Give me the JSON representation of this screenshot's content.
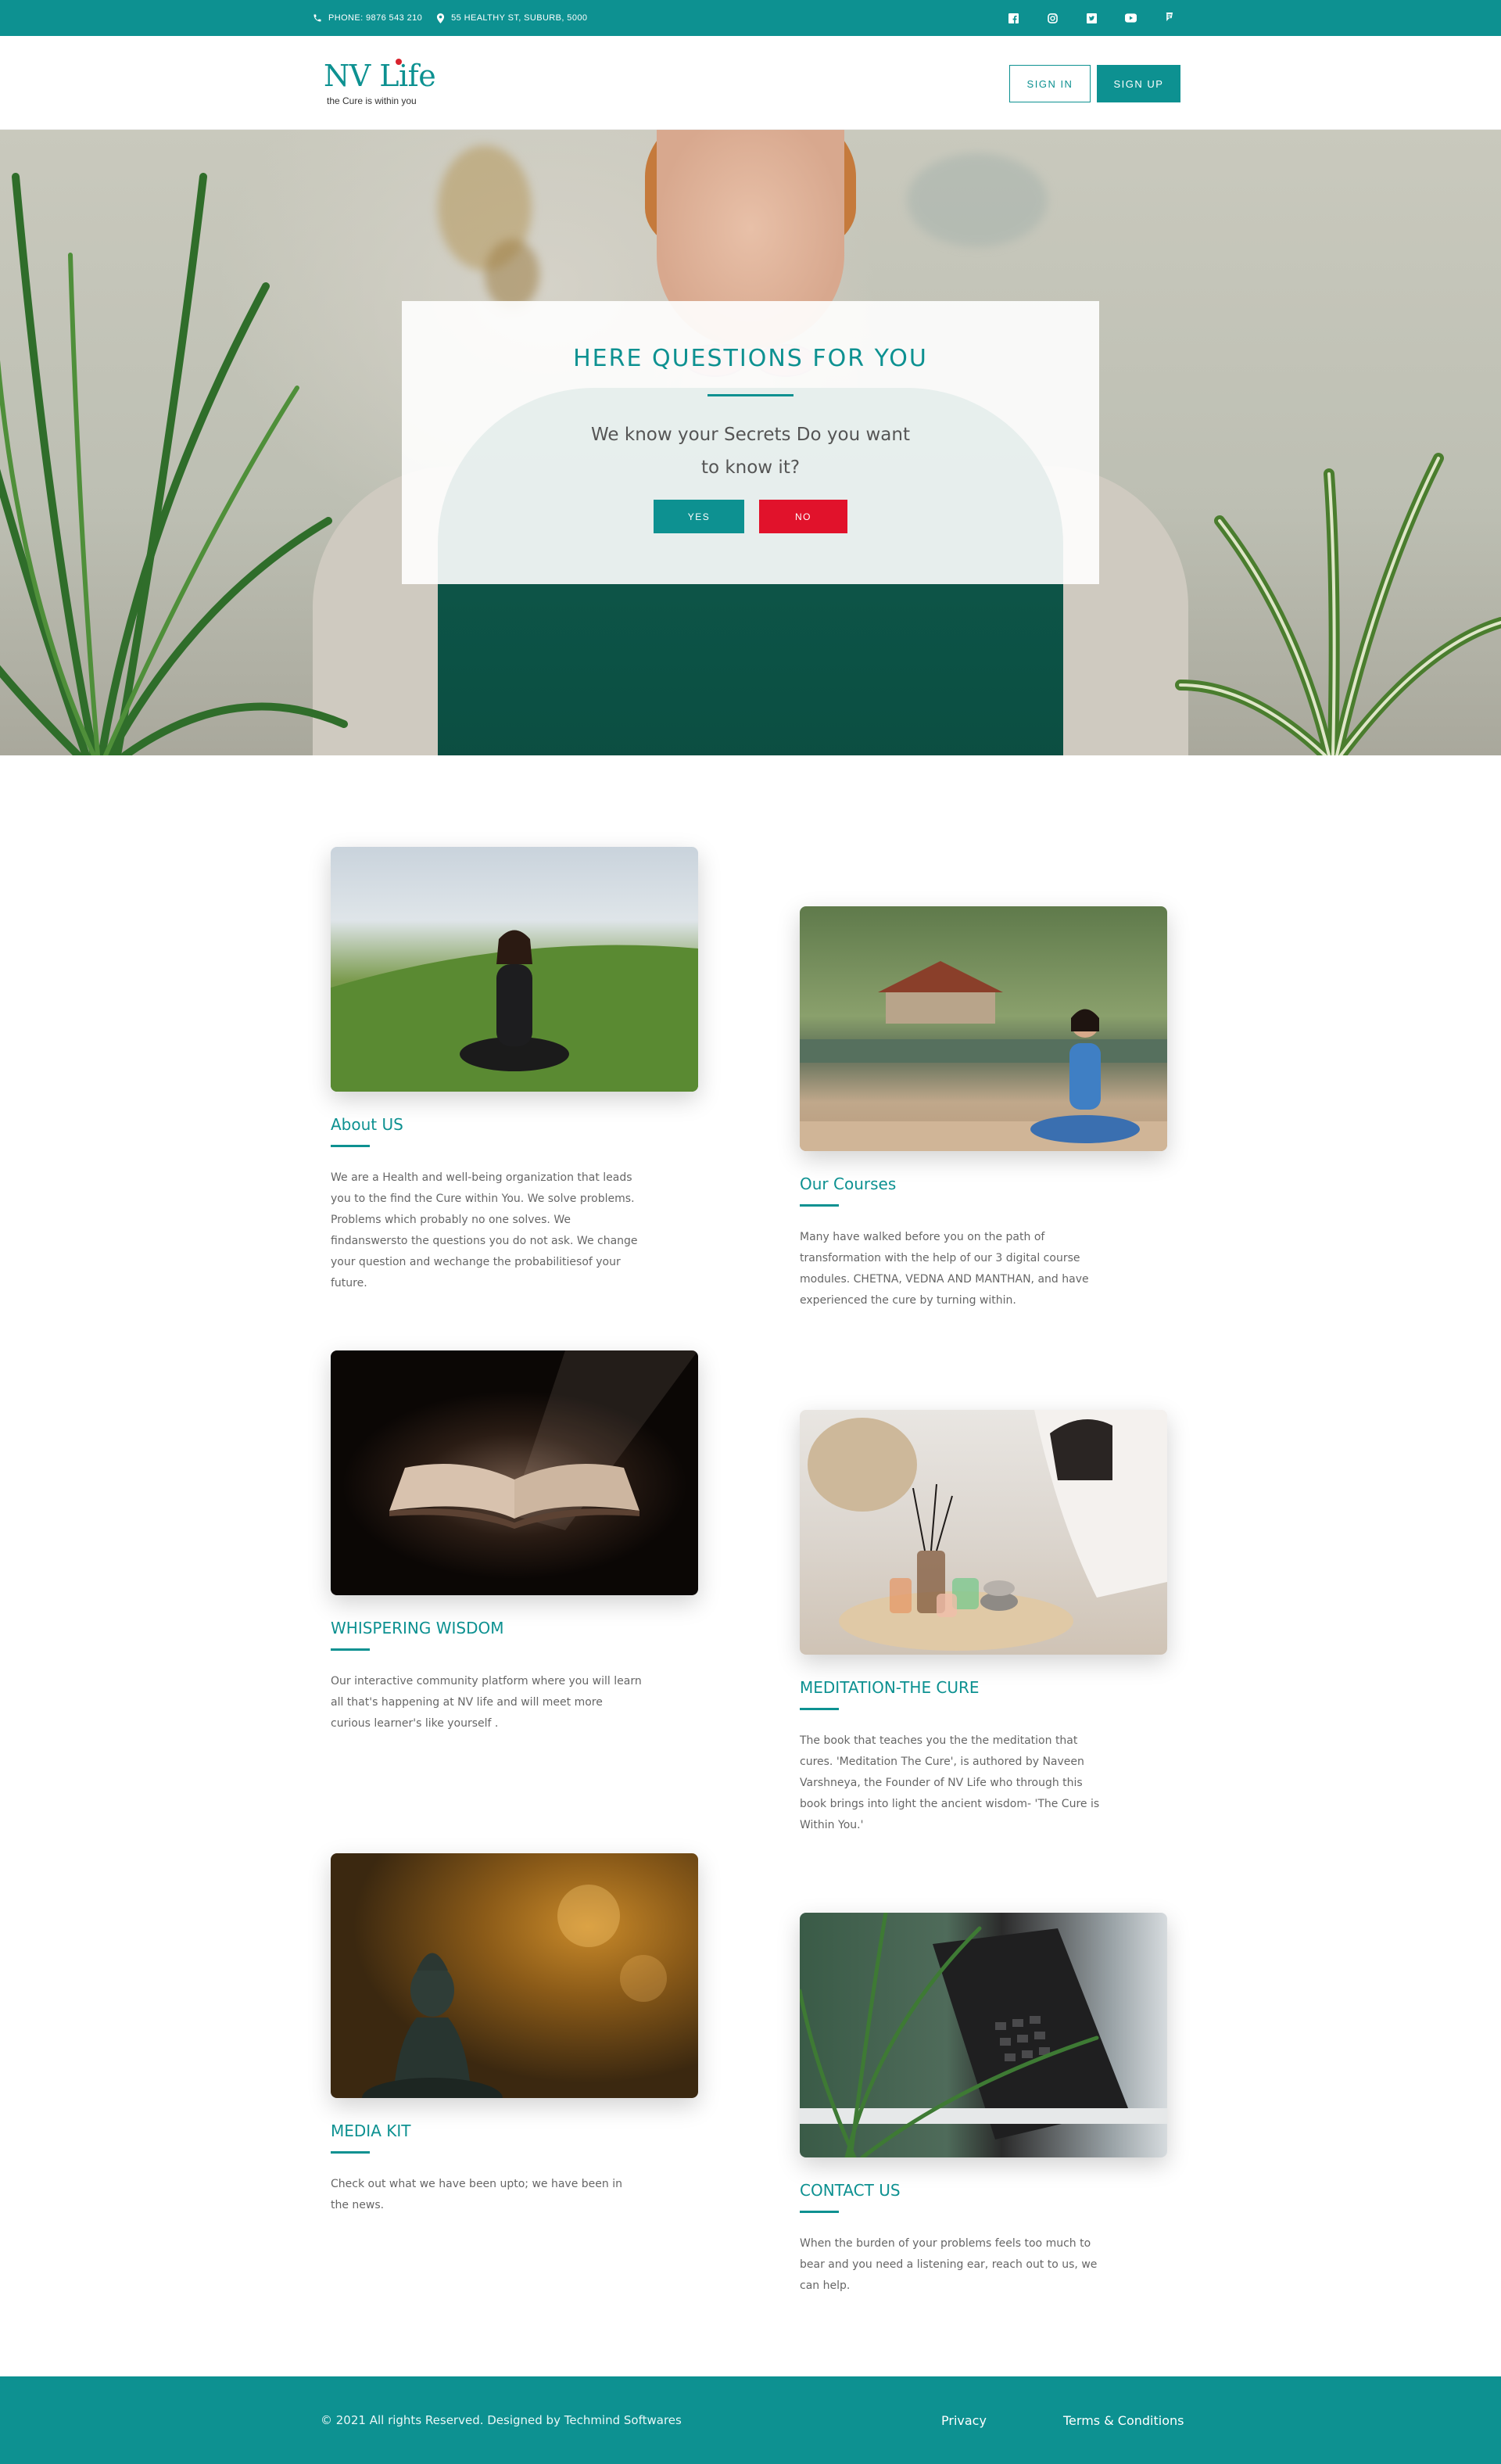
{
  "topbar": {
    "phone": "PHONE: 9876 543 210",
    "address": "55 HEALTHY ST, SUBURB, 5000",
    "socials": [
      "facebook-icon",
      "instagram-icon",
      "twitter-icon",
      "youtube-icon",
      "foursquare-icon"
    ]
  },
  "header": {
    "logo_text": "NV Life",
    "tagline": "the Cure is within you",
    "signin_label": "SIGN IN",
    "signup_label": "SIGN UP"
  },
  "hero": {
    "title": "HERE QUESTIONS FOR YOU",
    "text": "We know your Secrets Do you want to know it?",
    "yes_label": "YES",
    "no_label": "NO"
  },
  "cards": [
    {
      "title": "About US",
      "text": "We are a Health and well-being organization that leads you to the find the Cure within You. We solve problems. Problems which probably no one solves. We findanswersto the questions you do not ask. We change your question and wechange  the probabilitiesof your future."
    },
    {
      "title": "Our Courses",
      "text": "Many have walked before you on the path of transformation with the help of our 3 digital course modules. CHETNA, VEDNA AND MANTHAN, and have experienced the cure by turning within."
    },
    {
      "title": "WHISPERING WISDOM",
      "text": "Our interactive community platform where you will learn all that's happening at NV life and will meet more curious learner's like yourself ."
    },
    {
      "title": "MEDITATION-THE CURE",
      "text": "The book that teaches you the the meditation that cures. 'Meditation The Cure', is authored by Naveen Varshneya, the Founder of NV Life who through this book brings into light the ancient wisdom- 'The Cure is Within You.'"
    },
    {
      "title": "MEDIA KIT",
      "text": "Check out what we have been upto; we have been in the news."
    },
    {
      "title": "CONTACT US",
      "text": "When the burden of your problems feels too much to bear and you need a listening ear, reach out to us, we can help."
    }
  ],
  "footer": {
    "copyright": "© 2021 All rights Reserved. Designed by Techmind Softwares",
    "privacy": "Privacy",
    "terms": "Terms & Conditions"
  },
  "colors": {
    "brand": "#0d9191",
    "danger": "#e1122b"
  }
}
